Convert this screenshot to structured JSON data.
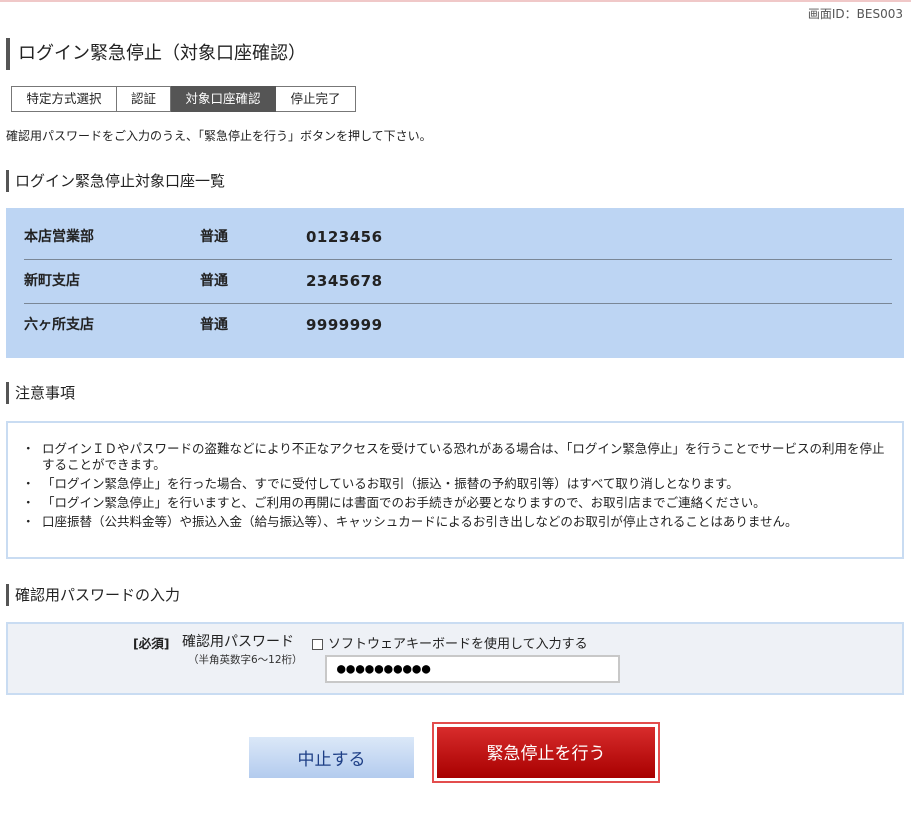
{
  "screen_id": "画面ID：BES003",
  "page_title": "ログイン緊急停止（対象口座確認）",
  "steps": [
    {
      "label": "特定方式選択",
      "active": false
    },
    {
      "label": "認証",
      "active": false
    },
    {
      "label": "対象口座確認",
      "active": true
    },
    {
      "label": "停止完了",
      "active": false
    }
  ],
  "instruction": "確認用パスワードをご入力のうえ、「緊急停止を行う」ボタンを押して下さい。",
  "accounts_section": {
    "heading": "ログイン緊急停止対象口座一覧",
    "rows": [
      {
        "branch": "本店営業部",
        "type": "普通",
        "number": "0123456"
      },
      {
        "branch": "新町支店",
        "type": "普通",
        "number": "2345678"
      },
      {
        "branch": "六ヶ所支店",
        "type": "普通",
        "number": "9999999"
      }
    ]
  },
  "notes_section": {
    "heading": "注意事項",
    "items": [
      "ログインＩＤやパスワードの盗難などにより不正なアクセスを受けている恐れがある場合は、「ログイン緊急停止」を行うことでサービスの利用を停止することができます。",
      "「ログイン緊急停止」を行った場合、すでに受付しているお取引（振込・振替の予約取引等）はすべて取り消しとなります。",
      "「ログイン緊急停止」を行いますと、ご利用の再開には書面でのお手続きが必要となりますので、お取引店までご連絡ください。",
      "口座振替（公共料金等）や振込入金（給与振込等）、キャッシュカードによるお引き出しなどのお取引が停止されることはありません。"
    ]
  },
  "password_section": {
    "heading": "確認用パスワードの入力",
    "required_label": "[必須]",
    "field_label": "確認用パスワード",
    "field_hint": "（半角英数字6～12桁）",
    "software_keyboard_label": "ソフトウェアキーボードを使用して入力する",
    "software_keyboard_checked": false,
    "value": "●●●●●●●●●●"
  },
  "buttons": {
    "cancel": "中止する",
    "emergency_stop": "緊急停止を行う"
  },
  "colors": {
    "accounts_bg": "#bdd5f3",
    "box_border": "#c9dcf2",
    "stop_button": "#b30000",
    "cancel_button": "#b3cbee",
    "step_active": "#555555"
  }
}
